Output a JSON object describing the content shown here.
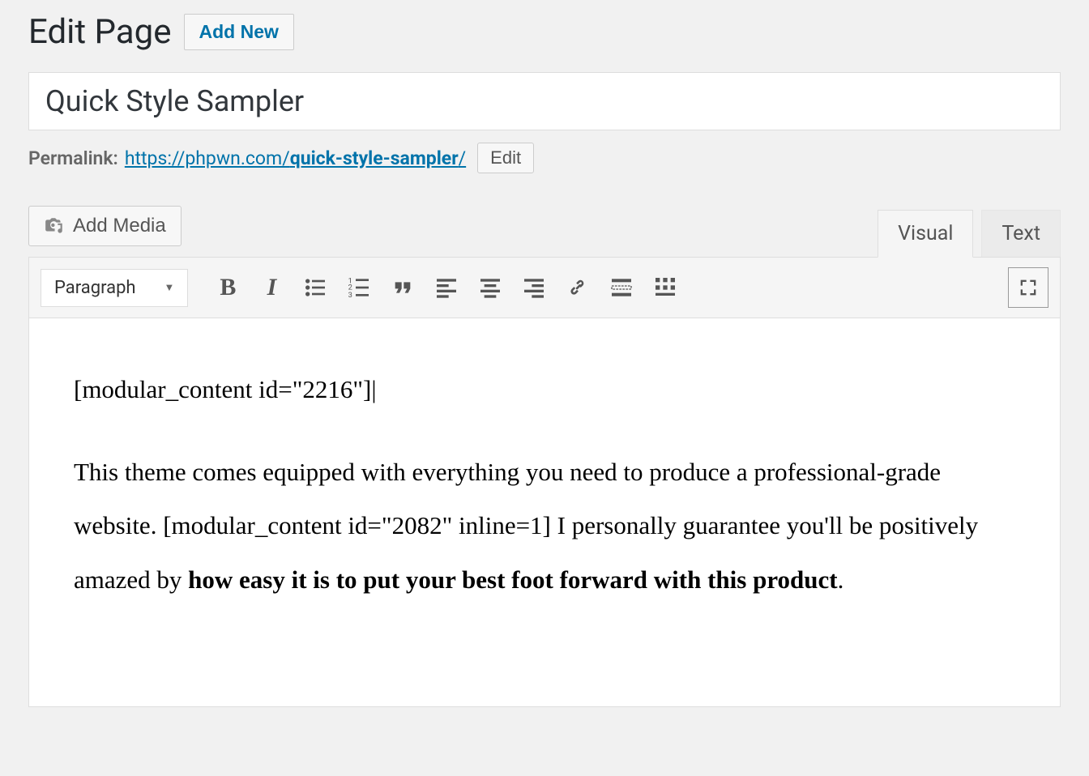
{
  "header": {
    "page_title": "Edit Page",
    "add_new_label": "Add New"
  },
  "title_input": {
    "value": "Quick Style Sampler"
  },
  "permalink": {
    "label": "Permalink:",
    "url_base": "https://phpwn.com/",
    "url_slug": "quick-style-sampler",
    "url_trailing": "/",
    "edit_label": "Edit"
  },
  "media": {
    "add_media_label": "Add Media"
  },
  "tabs": {
    "visual": "Visual",
    "text": "Text"
  },
  "toolbar": {
    "format": "Paragraph"
  },
  "content": {
    "line1": "[modular_content id=\"2216\"]",
    "para_part1": "This theme comes equipped with everything you need to produce a professional-grade website. [modular_content id=\"2082\" inline=1] I personally guarantee you'll be positively amazed by ",
    "para_bold": "how easy it is to put your best foot forward with this product",
    "para_end": "."
  }
}
